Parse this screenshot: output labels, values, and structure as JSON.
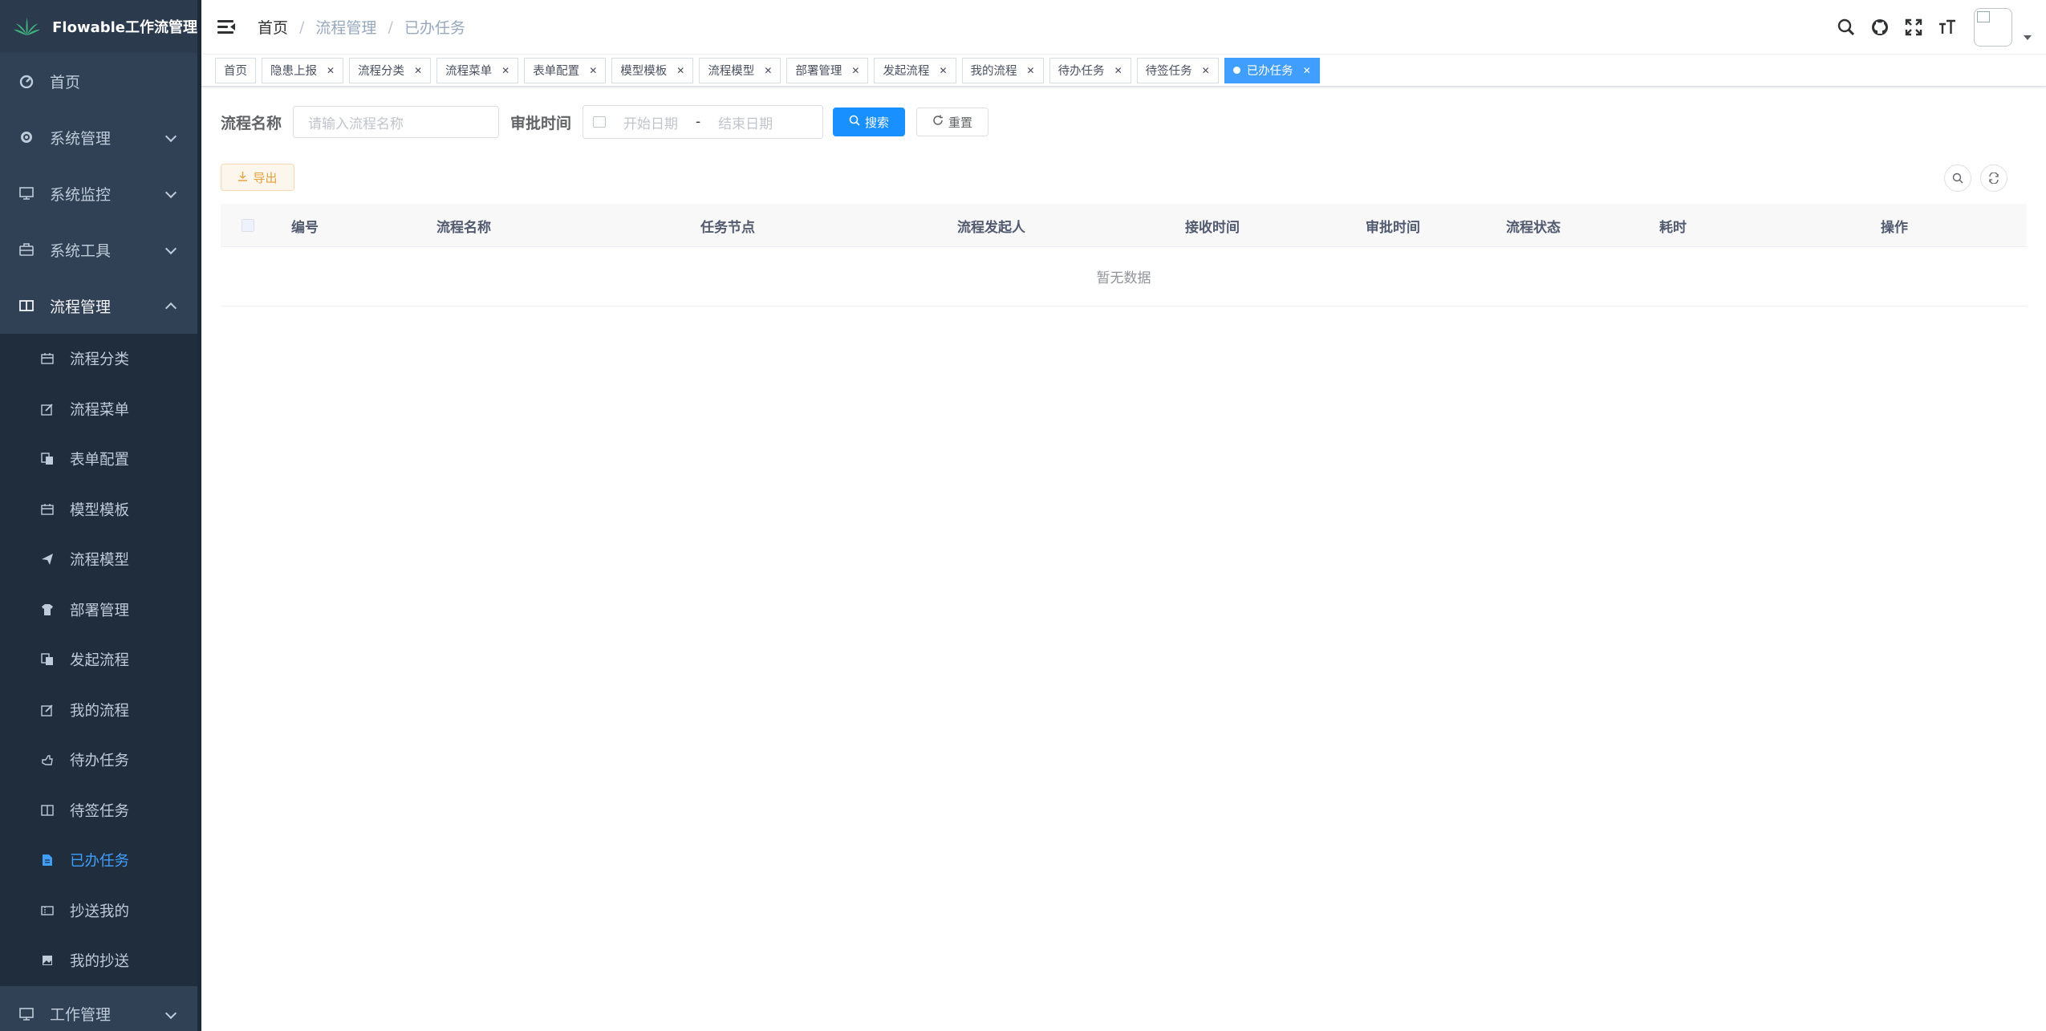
{
  "app": {
    "title": "Flowable工作流管理"
  },
  "sidebar": {
    "top_items": [
      {
        "label": "首页",
        "icon": "dashboard-icon"
      },
      {
        "label": "系统管理",
        "icon": "gear-icon"
      },
      {
        "label": "系统监控",
        "icon": "monitor-icon"
      },
      {
        "label": "系统工具",
        "icon": "toolbox-icon"
      },
      {
        "label": "流程管理",
        "icon": "book-icon"
      }
    ],
    "sub_items": [
      {
        "label": "流程分类",
        "icon": "calendar-icon"
      },
      {
        "label": "流程菜单",
        "icon": "edit-icon"
      },
      {
        "label": "表单配置",
        "icon": "copy-icon"
      },
      {
        "label": "模型模板",
        "icon": "calendar-icon"
      },
      {
        "label": "流程模型",
        "icon": "send-icon"
      },
      {
        "label": "部署管理",
        "icon": "shirt-icon"
      },
      {
        "label": "发起流程",
        "icon": "copy-icon"
      },
      {
        "label": "我的流程",
        "icon": "edit-icon"
      },
      {
        "label": "待办任务",
        "icon": "hand-icon"
      },
      {
        "label": "待签任务",
        "icon": "book-icon"
      },
      {
        "label": "已办任务",
        "icon": "document-icon"
      },
      {
        "label": "抄送我的",
        "icon": "ticket-icon"
      },
      {
        "label": "我的抄送",
        "icon": "image-icon"
      }
    ],
    "bottom_items": [
      {
        "label": "工作管理",
        "icon": "monitor-icon"
      }
    ],
    "active_sub": "已办任务"
  },
  "breadcrumb": [
    "首页",
    "流程管理",
    "已办任务"
  ],
  "tags": [
    "首页",
    "隐患上报",
    "流程分类",
    "流程菜单",
    "表单配置",
    "模型模板",
    "流程模型",
    "部署管理",
    "发起流程",
    "我的流程",
    "待办任务",
    "待签任务",
    "已办任务"
  ],
  "active_tag": "已办任务",
  "search": {
    "name_label": "流程名称",
    "name_placeholder": "请输入流程名称",
    "time_label": "审批时间",
    "start_placeholder": "开始日期",
    "range_sep": "-",
    "end_placeholder": "结束日期",
    "search_btn": "搜索",
    "reset_btn": "重置"
  },
  "toolbar": {
    "export_btn": "导出"
  },
  "table": {
    "columns": [
      "编号",
      "流程名称",
      "任务节点",
      "流程发起人",
      "接收时间",
      "审批时间",
      "流程状态",
      "耗时",
      "操作"
    ],
    "empty_text": "暂无数据"
  },
  "colors": {
    "sidebar_bg": "#304156",
    "submenu_bg": "#1f2d3d",
    "accent": "#409eff",
    "primary_btn": "#1890ff",
    "warning": "#e6a23c"
  }
}
